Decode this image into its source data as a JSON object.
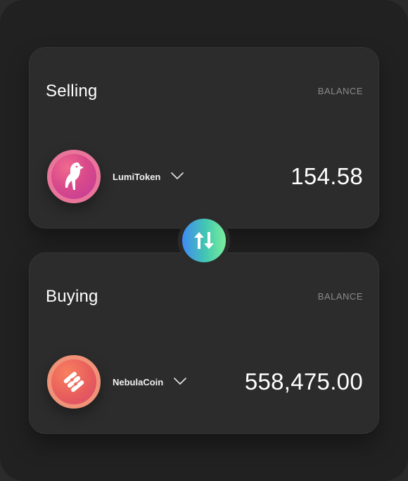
{
  "selling": {
    "title": "Selling",
    "balance_label": "BALANCE",
    "token": {
      "name": "LumiToken",
      "icon": "bird-icon"
    },
    "amount": "154.58"
  },
  "buying": {
    "title": "Buying",
    "balance_label": "BALANCE",
    "token": {
      "name": "NebulaCoin",
      "icon": "stripes-s-icon"
    },
    "amount": "558,475.00"
  },
  "swap": {
    "icon": "swap-arrows-icon",
    "colors": [
      "#3f8bf3",
      "#44c8b0",
      "#7bef9c"
    ]
  }
}
